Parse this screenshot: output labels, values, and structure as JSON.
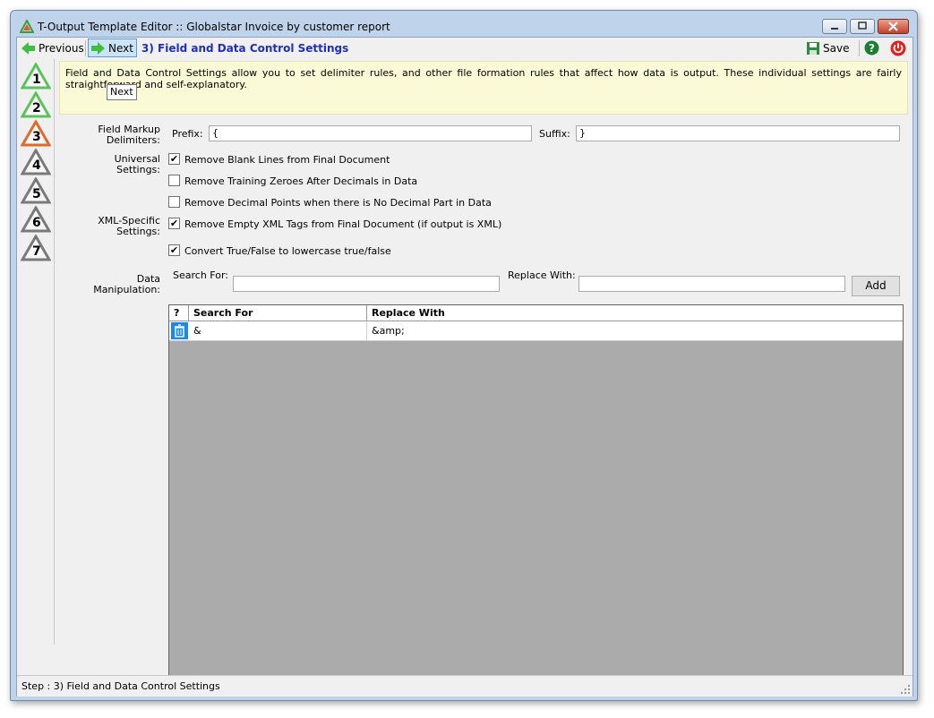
{
  "window": {
    "title": "T-Output Template Editor :: Globalstar Invoice by customer report"
  },
  "toolbar": {
    "previous_label": "Previous",
    "next_label": "Next",
    "step_title": "3) Field and Data Control Settings",
    "save_label": "Save",
    "help_icon": "help-icon",
    "power_icon": "power-icon"
  },
  "sidebar": {
    "steps": [
      {
        "label": "1",
        "color": "#5cc35c"
      },
      {
        "label": "2",
        "color": "#5cc35c"
      },
      {
        "label": "3",
        "color": "#e06a2a"
      },
      {
        "label": "4",
        "color": "#7a7a7a"
      },
      {
        "label": "5",
        "color": "#7a7a7a"
      },
      {
        "label": "6",
        "color": "#7a7a7a"
      },
      {
        "label": "7",
        "color": "#7a7a7a"
      }
    ]
  },
  "info": {
    "text": "Field and Data Control Settings allow you to set delimiter rules, and other file formation rules that affect how data is output. These individual settings are fairly straightforward and self-explanatory.",
    "tooltip": "Next"
  },
  "field_markup": {
    "label_line1": "Field Markup",
    "label_line2": "Delimiters:",
    "prefix_label": "Prefix:",
    "prefix_value": "{",
    "suffix_label": "Suffix:",
    "suffix_value": "}"
  },
  "universal": {
    "label": "Universal Settings:",
    "options": [
      {
        "label": "Remove Blank Lines from Final Document",
        "checked": true
      },
      {
        "label": "Remove Training Zeroes After Decimals in Data",
        "checked": false
      },
      {
        "label": "Remove Decimal Points when there is No Decimal Part in Data",
        "checked": false
      }
    ]
  },
  "xml": {
    "label_line1": "XML-Specific",
    "label_line2": "Settings:",
    "options": [
      {
        "label": "Remove Empty XML Tags from Final Document (if output is XML)",
        "checked": true
      },
      {
        "label": "Convert True/False to lowercase true/false",
        "checked": true
      }
    ]
  },
  "manipulation": {
    "label": "Data Manipulation:",
    "search_label": "Search For:",
    "search_value": "",
    "replace_label": "Replace With:",
    "replace_value": "",
    "add_label": "Add"
  },
  "grid": {
    "columns": [
      "?",
      "Search For",
      "Replace With"
    ],
    "rows": [
      {
        "search": "&",
        "replace": "&amp;"
      }
    ]
  },
  "status": {
    "text": "Step : 3) Field and Data Control Settings"
  }
}
